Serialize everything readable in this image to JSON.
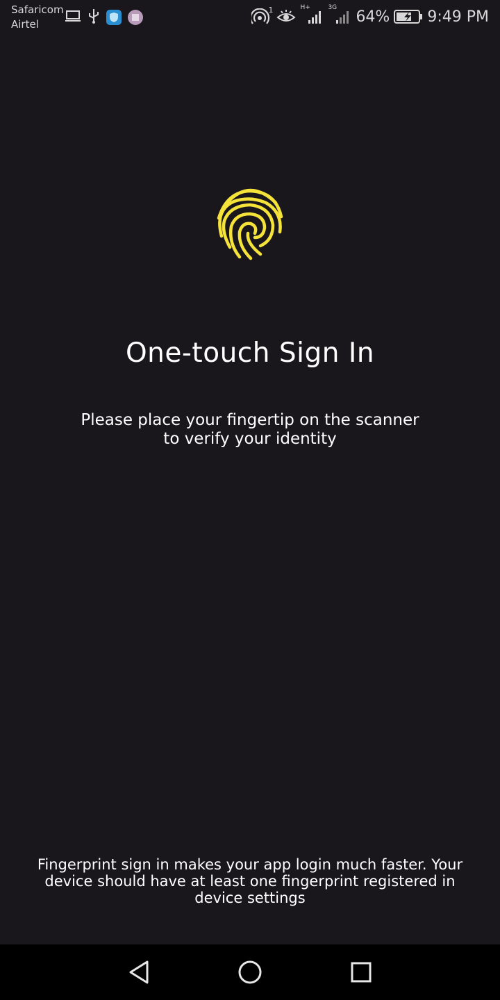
{
  "status_bar": {
    "carrier_primary": "Safaricom",
    "carrier_secondary": "Airtel",
    "battery_percent": "64%",
    "time": "9:49 PM",
    "hotspot_badge": "1",
    "network_1": "H+",
    "network_2": "3G",
    "icons_left": [
      "laptop-icon",
      "usb-icon",
      "shield-app-icon",
      "app-tile-icon"
    ],
    "icons_right": [
      "hotspot-icon",
      "eye-comfort-icon",
      "signal-icon",
      "signal-icon",
      "battery-charging-icon"
    ]
  },
  "main": {
    "icon": "fingerprint-icon",
    "title": "One-touch Sign In",
    "subtitle": "Please place your fingertip on the scanner\nto verify your identity",
    "footer_note": "Fingerprint sign in makes your app login much faster. Your device should have at least one fingerprint registered in device settings"
  },
  "colors": {
    "background": "#19161c",
    "accent": "#f6e33a",
    "text": "#ffffff",
    "nav_bar": "#000000"
  },
  "nav_bar": {
    "buttons": [
      "back-icon",
      "home-icon",
      "recents-icon"
    ]
  }
}
